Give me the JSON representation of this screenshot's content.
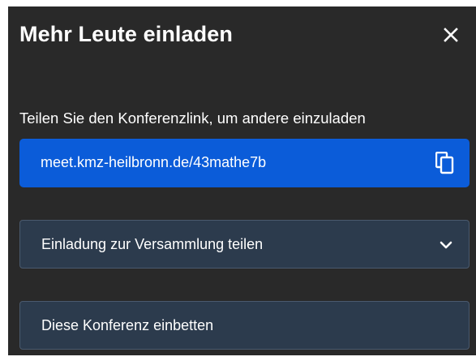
{
  "dialog": {
    "title": "Mehr Leute einladen",
    "close_icon": "close-icon"
  },
  "share_link": {
    "label": "Teilen Sie den Konferenzlink, um andere einzuladen",
    "url": "meet.kmz-heilbronn.de/43mathe7b",
    "copy_icon": "copy-icon"
  },
  "invite_share": {
    "label": "Einladung zur Versammlung teilen",
    "icon": "chevron-down-icon"
  },
  "embed": {
    "label": "Diese Konferenz einbetten"
  },
  "colors": {
    "background": "#292929",
    "link_box": "#0b5cd9",
    "row": "#2c3b4d"
  }
}
